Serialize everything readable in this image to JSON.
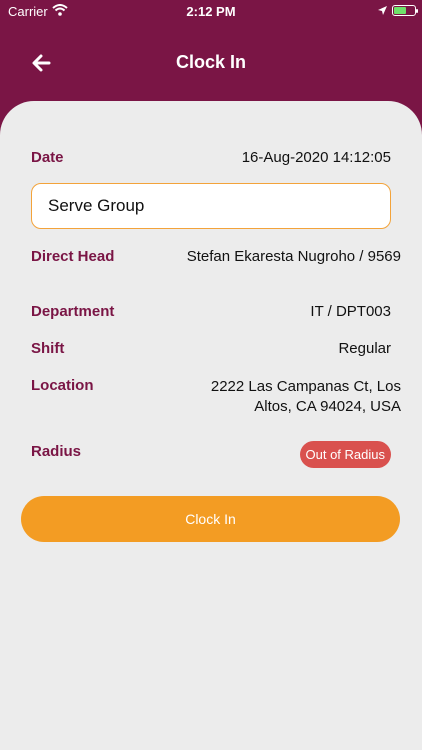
{
  "status_bar": {
    "carrier": "Carrier",
    "time": "2:12 PM"
  },
  "header": {
    "title": "Clock In"
  },
  "form": {
    "date_label": "Date",
    "date_value": "16-Aug-2020 14:12:05",
    "group_value": "Serve Group",
    "direct_head_label": "Direct Head",
    "direct_head_value": "Stefan Ekaresta Nugroho / 9569",
    "department_label": "Department",
    "department_value": "IT / DPT003",
    "shift_label": "Shift",
    "shift_value": "Regular",
    "location_label": "Location",
    "location_value_line1": "2222 Las Campanas Ct, Los",
    "location_value_line2": "Altos, CA 94024, USA",
    "radius_label": "Radius",
    "radius_status": "Out of Radius"
  },
  "actions": {
    "clock_in_label": "Clock In"
  },
  "colors": {
    "brand": "#7a1545",
    "accent": "#f39c23",
    "danger": "#d9514e",
    "input_border": "#f3a33a"
  }
}
